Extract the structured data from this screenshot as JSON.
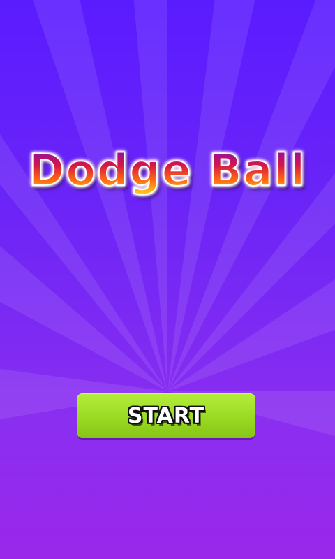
{
  "game": {
    "title": "Dodge Ball",
    "start_label": "START"
  },
  "colors": {
    "background_top": "#5a1bff",
    "background_bottom": "#9a27ea",
    "button_green": "#9ada24",
    "title_gradient": [
      "#7a0cbf",
      "#d4174a",
      "#ff6a10",
      "#ffd21a"
    ]
  }
}
